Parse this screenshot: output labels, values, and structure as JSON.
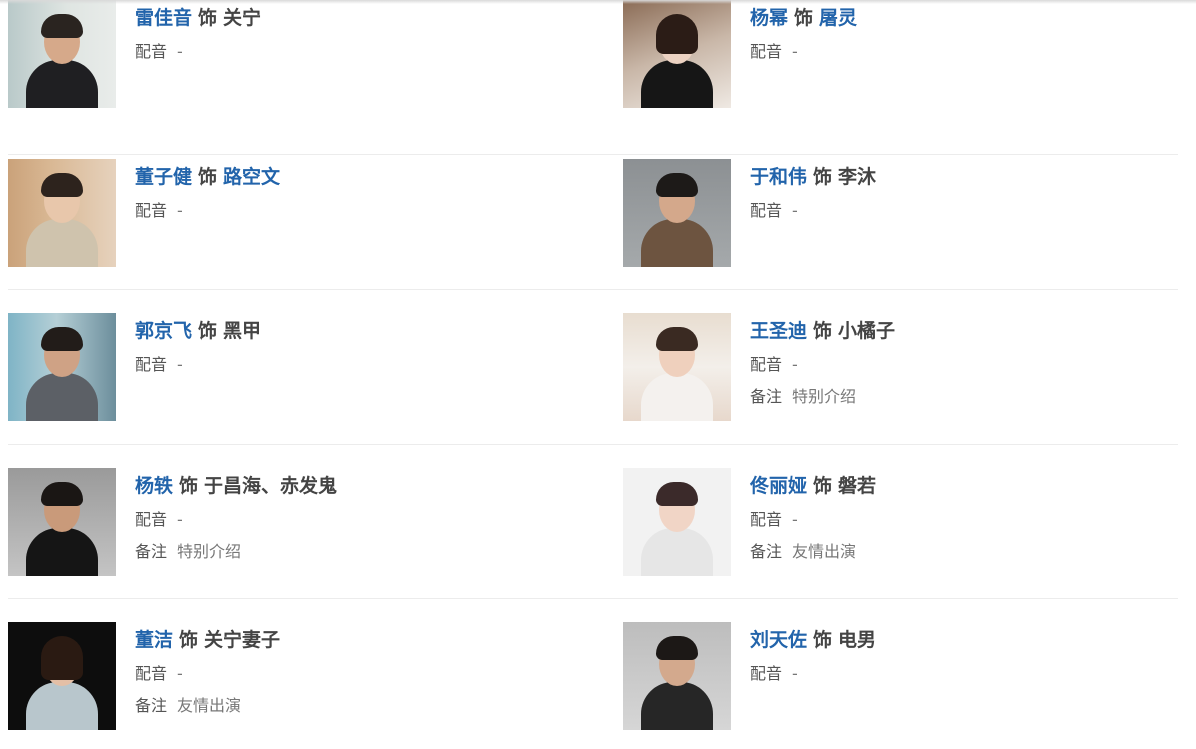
{
  "labels": {
    "as": "饰",
    "dub": "配音",
    "note": "备注"
  },
  "colors": {
    "link": "#2264ab",
    "text": "#444444",
    "divider": "#ececec"
  },
  "rows": [
    {
      "left": {
        "actor": "雷佳音",
        "role": "关宁",
        "role_link": false,
        "dub": "-",
        "note": null,
        "photo": "portrait-man-suit"
      },
      "right": {
        "actor": "杨幂",
        "role": "屠灵",
        "role_link": true,
        "dub": "-",
        "note": null,
        "photo": "portrait-woman-dark-hair"
      }
    },
    {
      "left": {
        "actor": "董子健",
        "role": "路空文",
        "role_link": true,
        "dub": "-",
        "note": null,
        "photo": "portrait-man-light-suit"
      },
      "right": {
        "actor": "于和伟",
        "role": "李沐",
        "role_link": false,
        "dub": "-",
        "note": null,
        "photo": "portrait-man-plaid-coat"
      }
    },
    {
      "left": {
        "actor": "郭京飞",
        "role": "黑甲",
        "role_link": false,
        "dub": "-",
        "note": null,
        "photo": "portrait-man-grey-suit"
      },
      "right": {
        "actor": "王圣迪",
        "role": "小橘子",
        "role_link": false,
        "dub": "-",
        "note": "特别介绍",
        "photo": "portrait-girl-teddy-bear"
      }
    },
    {
      "left": {
        "actor": "杨轶",
        "role": "于昌海、赤发鬼",
        "role_link": false,
        "dub": "-",
        "note": "特别介绍",
        "photo": "portrait-man-black-turtleneck"
      },
      "right": {
        "actor": "佟丽娅",
        "role": "磐若",
        "role_link": false,
        "dub": "-",
        "note": "友情出演",
        "photo": "portrait-woman-short-hair"
      }
    },
    {
      "left": {
        "actor": "董洁",
        "role": "关宁妻子",
        "role_link": false,
        "dub": "-",
        "note": "友情出演",
        "photo": "portrait-woman-black-bg"
      },
      "right": {
        "actor": "刘天佐",
        "role": "电男",
        "role_link": false,
        "dub": "-",
        "note": null,
        "photo": "portrait-man-sitting-gesture"
      }
    }
  ]
}
